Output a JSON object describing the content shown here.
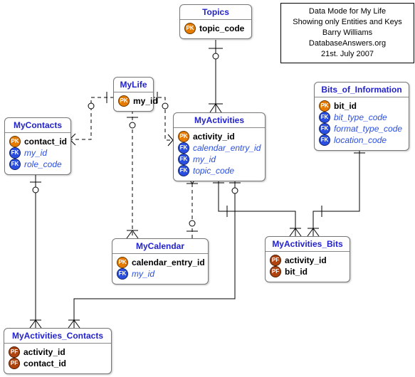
{
  "info": {
    "line1": "Data Mode for My Life",
    "line2": "Showing only Entities and Keys",
    "line3": "Barry Williams",
    "line4": "DatabaseAnswers.org",
    "line5": "21st. July 2007"
  },
  "entities": {
    "topics": {
      "title": "Topics",
      "topic_code": "topic_code"
    },
    "mylife": {
      "title": "MyLife",
      "my_id": "my_id"
    },
    "mycontacts": {
      "title": "MyContacts",
      "contact_id": "contact_id",
      "my_id": "my_id",
      "role_code": "role_code"
    },
    "myactivities": {
      "title": "MyActivities",
      "activity_id": "activity_id",
      "calendar_entry_id": "calendar_entry_id",
      "my_id": "my_id",
      "topic_code": "topic_code"
    },
    "bits": {
      "title": "Bits_of_Information",
      "bit_id": "bit_id",
      "bit_type_code": "bit_type_code",
      "format_type_code": "format_type_code",
      "location_code": "location_code"
    },
    "mycalendar": {
      "title": "MyCalendar",
      "calendar_entry_id": "calendar_entry_id",
      "my_id": "my_id"
    },
    "myactivities_bits": {
      "title": "MyActivities_Bits",
      "activity_id": "activity_id",
      "bit_id": "bit_id"
    },
    "myactivities_contacts": {
      "title": "MyActivities_Contacts",
      "activity_id": "activity_id",
      "contact_id": "contact_id"
    }
  },
  "key_labels": {
    "pk": "PK",
    "fk": "FK",
    "pf": "PF"
  }
}
